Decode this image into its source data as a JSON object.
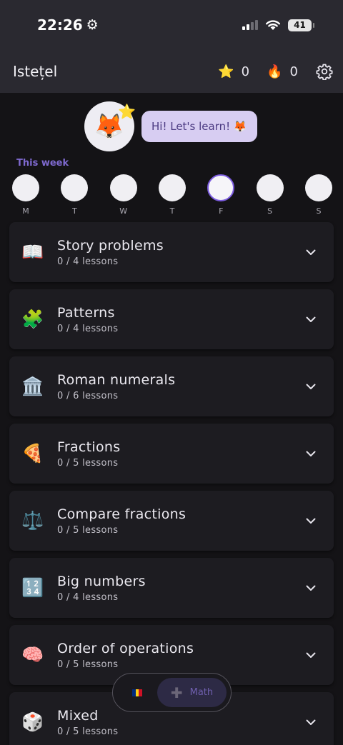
{
  "status_bar": {
    "time": "22:26",
    "battery": "41"
  },
  "app_bar": {
    "title": "Istețel",
    "stars": "0",
    "streak": "0"
  },
  "hero": {
    "greeting": "Hi! Let's learn! 🦊",
    "mascot": "🦊",
    "badge": "⭐"
  },
  "week": {
    "label": "This week",
    "days": [
      {
        "letter": "M",
        "today": false
      },
      {
        "letter": "T",
        "today": false
      },
      {
        "letter": "W",
        "today": false
      },
      {
        "letter": "T",
        "today": false
      },
      {
        "letter": "F",
        "today": true
      },
      {
        "letter": "S",
        "today": false
      },
      {
        "letter": "S",
        "today": false
      }
    ]
  },
  "topics": [
    {
      "name": "Story problems",
      "progress": "0 / 4 lessons",
      "icon": "📖",
      "icon_name": "book-icon"
    },
    {
      "name": "Patterns",
      "progress": "0 / 4 lessons",
      "icon": "🧩",
      "icon_name": "puzzle-icon"
    },
    {
      "name": "Roman numerals",
      "progress": "0 / 6 lessons",
      "icon": "🏛️",
      "icon_name": "classical-building-icon"
    },
    {
      "name": "Fractions",
      "progress": "0 / 5 lessons",
      "icon": "🍕",
      "icon_name": "pizza-icon"
    },
    {
      "name": "Compare fractions",
      "progress": "0 / 5 lessons",
      "icon": "⚖️",
      "icon_name": "balance-scale-icon"
    },
    {
      "name": "Big numbers",
      "progress": "0 / 4 lessons",
      "icon": "🔢",
      "icon_name": "numbers-icon"
    },
    {
      "name": "Order of operations",
      "progress": "0 / 5 lessons",
      "icon": "🧠",
      "icon_name": "brain-icon"
    },
    {
      "name": "Mixed",
      "progress": "0 / 5 lessons",
      "icon": "🎲",
      "icon_name": "dice-icon"
    }
  ],
  "bottom_nav": {
    "math_label": "Math",
    "flag_colors": [
      "#002b7f",
      "#fcd116",
      "#ce1126"
    ]
  },
  "colors": {
    "accent": "#7c5ce0",
    "bubble": "#d7cdf2",
    "background": "#141316"
  }
}
